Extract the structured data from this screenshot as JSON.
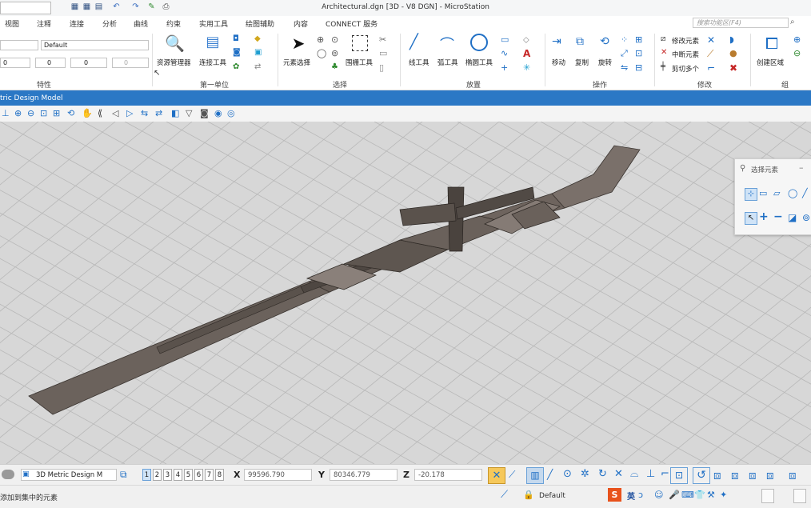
{
  "titlebar": {
    "title": "Architectural.dgn [3D - V8 DGN] - MicroStation"
  },
  "menu": {
    "tabs": [
      "视图",
      "注释",
      "连接",
      "分析",
      "曲线",
      "约束",
      "实用工具",
      "绘图辅助",
      "内容",
      "CONNECT 服务"
    ],
    "search_placeholder": "搜索功能区(F4)"
  },
  "ribbon": {
    "attributes": {
      "level_value": "Default",
      "color_value": "0",
      "weight_value": "0",
      "style_value": "0",
      "transparency_value": "0",
      "group_label": "特性"
    },
    "primary": {
      "resource_manager": "资源管理器",
      "attach_tools": "连接工具",
      "group_label": "第一单位"
    },
    "selection": {
      "element_select": "元素选择",
      "fence_tools": "围栅工具",
      "group_label": "选择"
    },
    "placement": {
      "line_tools": "线工具",
      "arc_tools": "弧工具",
      "ellipse_tools": "椭圆工具",
      "group_label": "放置"
    },
    "manipulate": {
      "move": "移动",
      "copy": "复制",
      "rotate": "旋转",
      "group_label": "操作"
    },
    "modify": {
      "modify_element": "修改元素",
      "break_element": "中断元素",
      "trim_to_multiple": "剪切多个",
      "group_label": "修改"
    },
    "group": {
      "create_region": "创建区域",
      "group_label": "组"
    }
  },
  "view": {
    "title": "tric Design Model",
    "view_combo": "3D Metric Design M",
    "view_numbers": [
      "1",
      "2",
      "3",
      "4",
      "5",
      "6",
      "7",
      "8"
    ]
  },
  "palette": {
    "title": "选择元素"
  },
  "status": {
    "x_label": "X",
    "x_value": "99596.790",
    "y_label": "Y",
    "y_value": "80346.779",
    "z_label": "Z",
    "z_value": "-20.178",
    "prompt": "添加到集中的元素",
    "active_level": "Default",
    "ime_label": "英"
  },
  "colors": {
    "accent": "#2b78c5",
    "viewport_bg": "#d7d7d7",
    "model": "#6b625c",
    "grid": "#b8b8b8"
  }
}
